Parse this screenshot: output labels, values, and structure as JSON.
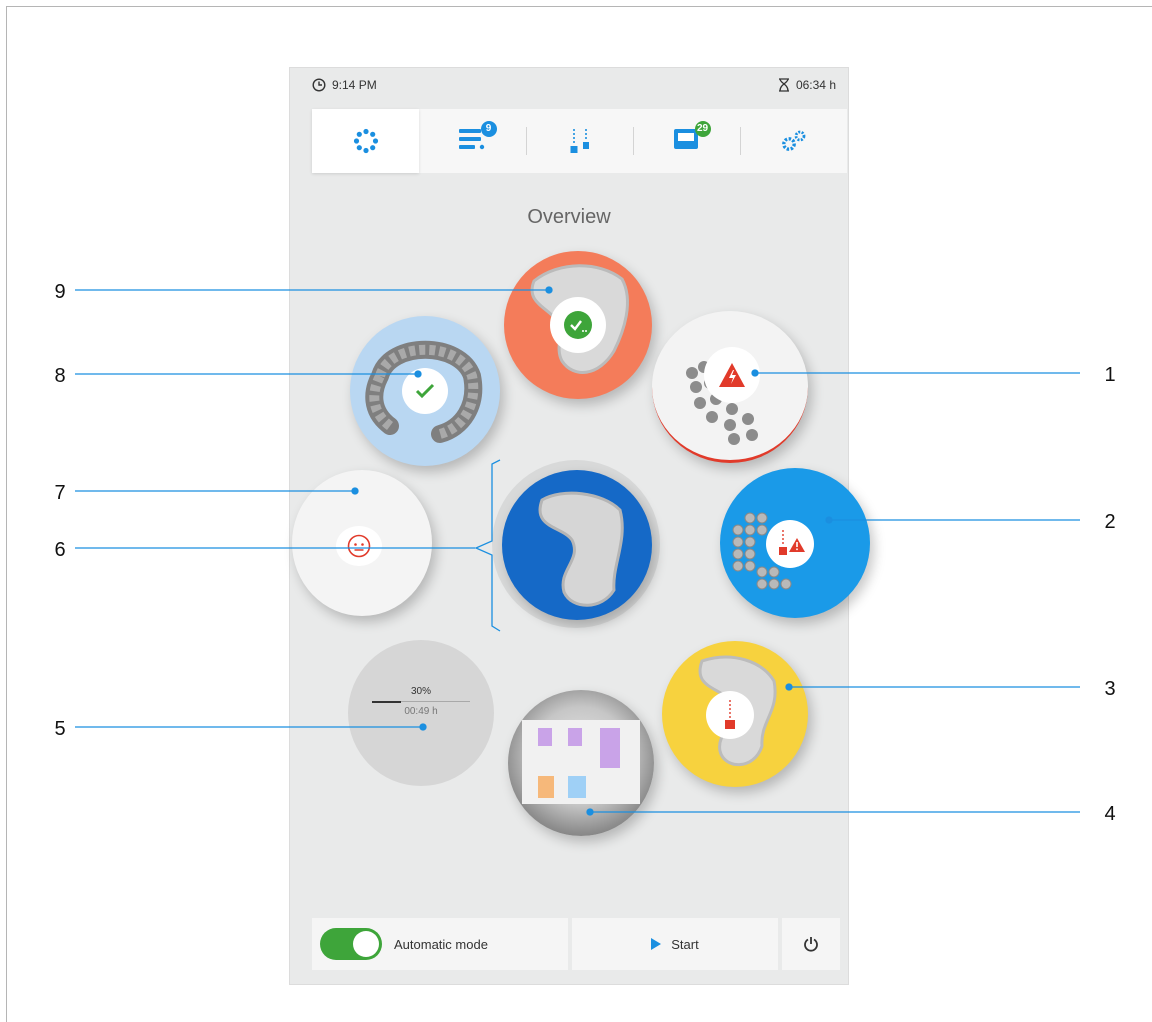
{
  "status": {
    "time": "9:14 PM",
    "remaining": "06:34 h"
  },
  "tabs": [
    {
      "icon": "overview-icon",
      "badge": ""
    },
    {
      "icon": "job-list-icon",
      "badge": "9"
    },
    {
      "icon": "tools-icon",
      "badge": ""
    },
    {
      "icon": "material-icon",
      "badge": "29"
    },
    {
      "icon": "settings-icon",
      "badge": ""
    }
  ],
  "title": "Overview",
  "progress": {
    "percent_label": "30%",
    "percent": 30,
    "time": "00:49 h"
  },
  "bottom": {
    "mode_label": "Automatic mode",
    "auto_mode_on": true,
    "start_label": "Start"
  },
  "colors": {
    "accent_blue": "#1b8fe0",
    "green": "#3ea53a",
    "orange": "#f47c5a",
    "yellow": "#f7d23e",
    "red": "#e13a2a"
  },
  "callouts": [
    "1",
    "2",
    "3",
    "4",
    "5",
    "6",
    "7",
    "8",
    "9"
  ]
}
